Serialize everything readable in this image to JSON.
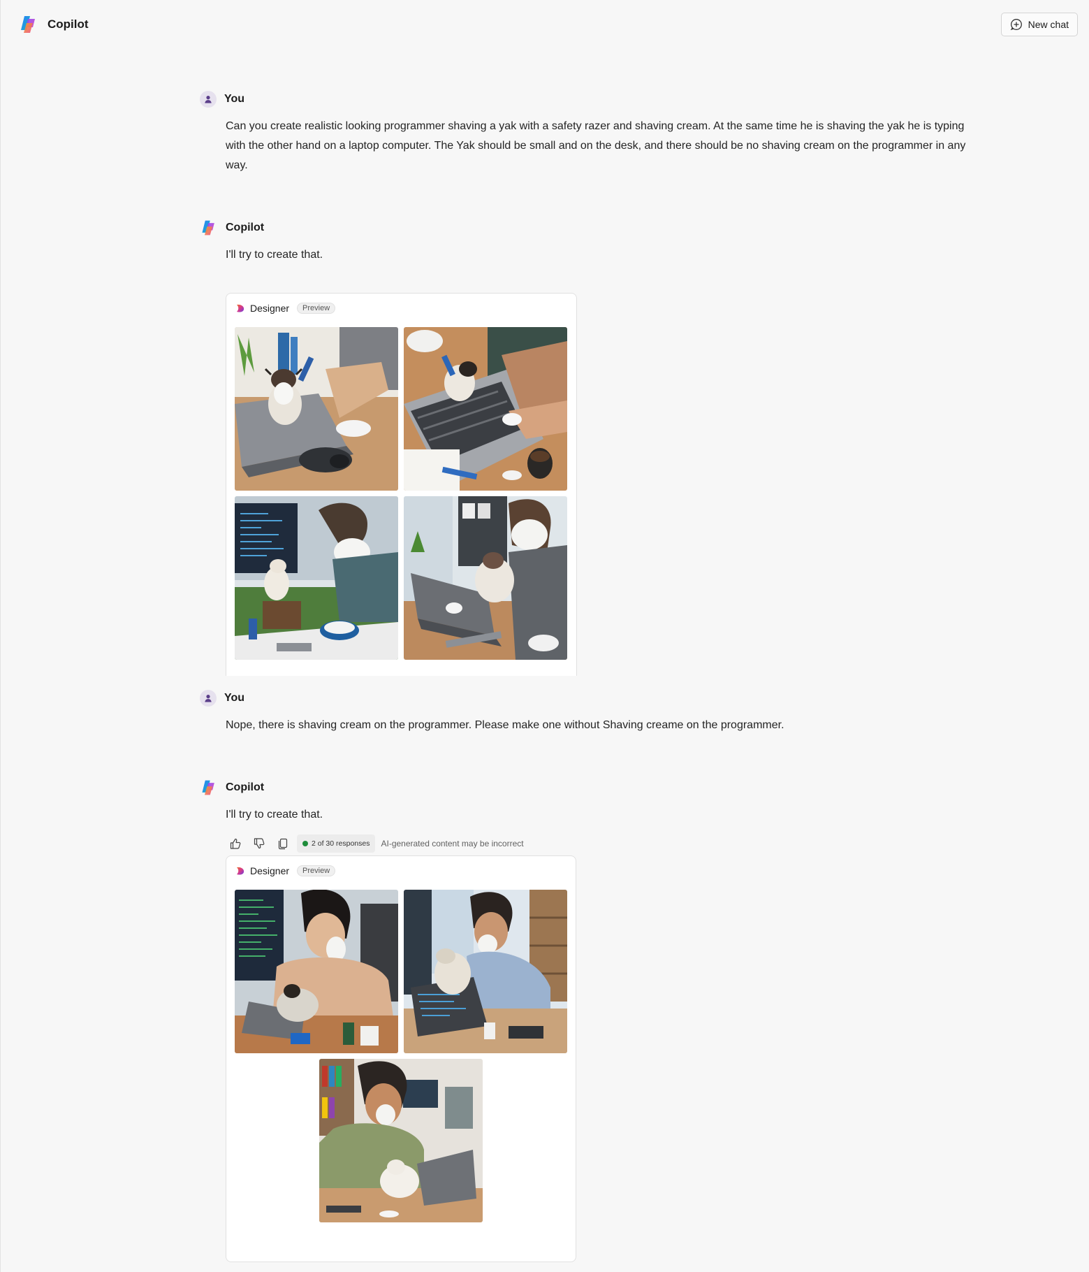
{
  "header": {
    "app_name": "Copilot",
    "new_chat_label": "New chat"
  },
  "messages": [
    {
      "author": "You",
      "text": "Can you create realistic looking programmer shaving a yak with a safety razer and shaving cream.  At the same time he is shaving the yak he is typing with  the other hand on a laptop computer.  The Yak should be small and on the desk, and there should be no shaving cream on the programmer in any way."
    },
    {
      "author": "Copilot",
      "text": "I'll try to create that.",
      "designer": {
        "name": "Designer",
        "badge": "Preview",
        "image_count": 4
      }
    },
    {
      "author": "You",
      "text": "Nope, there is shaving cream on the programmer.  Please make one without Shaving creame on the programmer."
    },
    {
      "author": "Copilot",
      "text": "I'll try to create that.",
      "feedback": {
        "response_count": "2 of 30 responses",
        "disclaimer": "AI-generated content may be incorrect"
      },
      "designer": {
        "name": "Designer",
        "badge": "Preview",
        "image_count": 3
      }
    }
  ],
  "icons": {
    "brand": "copilot-logo-icon",
    "new_chat": "chat-add-icon",
    "user_avatar": "person-icon",
    "thumbs_up": "thumbs-up-icon",
    "thumbs_down": "thumbs-down-icon",
    "copy": "copy-icon"
  },
  "colors": {
    "background": "#f7f7f7",
    "card": "#ffffff",
    "status_green": "#1e8c3a"
  }
}
